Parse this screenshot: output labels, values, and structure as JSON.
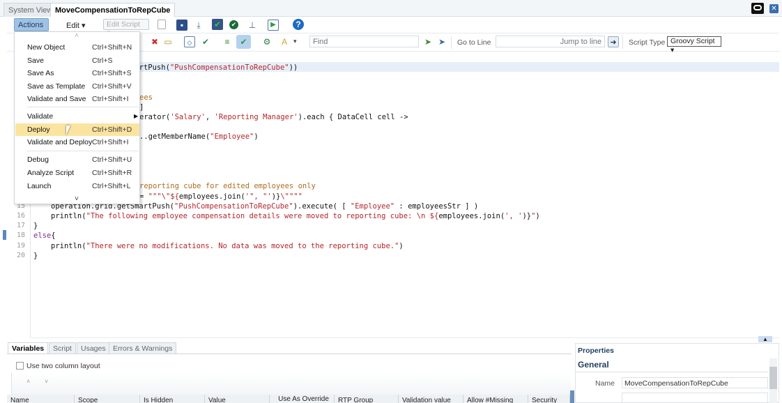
{
  "tabs": [
    {
      "label": "System View",
      "active": false
    },
    {
      "label": "MoveCompensationToRepCube",
      "active": true
    }
  ],
  "toolbar": {
    "actions_label": "Actions",
    "edit_label": "Edit",
    "edit_script_label": "Edit Script",
    "find_placeholder": "Find",
    "goto_label": "Go to Line",
    "jump_placeholder": "Jump to line",
    "script_type_label": "Script Type",
    "script_type_value": "Groovy Script"
  },
  "menu": {
    "items": [
      {
        "label": "New Object",
        "shortcut": "Ctrl+Shift+N"
      },
      {
        "label": "Save",
        "shortcut": "Ctrl+S"
      },
      {
        "label": "Save As",
        "shortcut": "Ctrl+Shift+S"
      },
      {
        "label": "Save as Template",
        "shortcut": "Ctrl+Shift+V"
      },
      {
        "label": "Validate and Save",
        "shortcut": "Ctrl+Shift+I",
        "sep_after": true
      },
      {
        "label": "Validate",
        "shortcut": "",
        "submenu": true
      },
      {
        "label": "Deploy",
        "shortcut": "Ctrl+Shift+D",
        "highlighted": true
      },
      {
        "label": "Validate and Deploy",
        "shortcut": "Ctrl+Shift+I",
        "sep_after": true
      },
      {
        "label": "Debug",
        "shortcut": "Ctrl+Shift+U"
      },
      {
        "label": "Analyze Script",
        "shortcut": "Ctrl+Shift+R"
      },
      {
        "label": "Launch",
        "shortcut": "Ctrl+Shift+L"
      }
    ]
  },
  "editor": {
    "lines": [
      {
        "n": 1,
        "indent": 187,
        "parts": [
          {
            "t": "martPush(",
            "c": "d"
          },
          {
            "t": "\"PushCompensationToRepCube\"",
            "c": "s"
          },
          {
            "t": "))",
            "c": "d"
          }
        ]
      },
      {
        "n": 4,
        "indent": 200,
        "parts": [
          {
            "t": "ees",
            "c": "c"
          }
        ]
      },
      {
        "n": 5,
        "indent": 200,
        "parts": [
          {
            "t": "]",
            "c": "d"
          }
        ]
      },
      {
        "n": 6,
        "indent": 200,
        "parts": [
          {
            "t": "erator(",
            "c": "d"
          },
          {
            "t": "'Salary'",
            "c": "s"
          },
          {
            "t": ", ",
            "c": "d"
          },
          {
            "t": "'Reporting Manager'",
            "c": "s"
          },
          {
            "t": ").each { DataCell cell ->",
            "c": "d"
          }
        ]
      },
      {
        "n": 8,
        "indent": 200,
        "parts": [
          {
            "t": "..getMemberName(",
            "c": "d"
          },
          {
            "t": "\"Employee\"",
            "c": "s"
          },
          {
            "t": ")",
            "c": "d"
          }
        ]
      },
      {
        "n": 13,
        "indent": 200,
        "parts": [
          {
            "t": "reporting cube for edited employees only",
            "c": "c"
          }
        ]
      },
      {
        "n": 14,
        "indent": 200,
        "parts": [
          {
            "t": "= ",
            "c": "d"
          },
          {
            "t": "\"\"\"\\\"${",
            "c": "s"
          },
          {
            "t": "employees.join(",
            "c": "d"
          },
          {
            "t": "'\", \"'",
            "c": "s"
          },
          {
            "t": ")}",
            "c": "d"
          },
          {
            "t": "\\\"\"\"\"",
            "c": "s"
          }
        ]
      },
      {
        "n": 15,
        "indent": 73,
        "parts": [
          {
            "t": "operation.grid.getSmartPush(",
            "c": "d"
          },
          {
            "t": "\"PushCompensationToRepCube\"",
            "c": "s"
          },
          {
            "t": ").execute( [ ",
            "c": "d"
          },
          {
            "t": "\"Employee\"",
            "c": "s"
          },
          {
            "t": " : employeesStr ] )",
            "c": "d"
          }
        ]
      },
      {
        "n": 16,
        "indent": 73,
        "parts": [
          {
            "t": "println(",
            "c": "d"
          },
          {
            "t": "\"The following employee compensation details were moved to reporting cube: \\n ${",
            "c": "s"
          },
          {
            "t": "employees.join(",
            "c": "d"
          },
          {
            "t": "', '",
            "c": "s"
          },
          {
            "t": ")}",
            "c": "d"
          },
          {
            "t": "\"",
            "c": "s"
          },
          {
            "t": ")",
            "c": "d"
          }
        ]
      },
      {
        "n": 17,
        "indent": 48,
        "parts": [
          {
            "t": "}",
            "c": "d"
          }
        ]
      },
      {
        "n": 18,
        "indent": 48,
        "parts": [
          {
            "t": "else",
            "c": "k"
          },
          {
            "t": "{",
            "c": "d"
          }
        ]
      },
      {
        "n": 19,
        "indent": 73,
        "parts": [
          {
            "t": "println(",
            "c": "d"
          },
          {
            "t": "\"There were no modifications. No data was moved to the reporting cube.\"",
            "c": "s"
          },
          {
            "t": ")",
            "c": "d"
          }
        ]
      },
      {
        "n": 20,
        "indent": 48,
        "parts": [
          {
            "t": "}",
            "c": "d"
          }
        ]
      }
    ]
  },
  "bottom": {
    "tabs": [
      {
        "label": "Variables",
        "active": true
      },
      {
        "label": "Script"
      },
      {
        "label": "Usages"
      },
      {
        "label": "Errors & Warnings"
      }
    ],
    "two_column_label": "Use two column layout",
    "two_column_checked": false,
    "columns": [
      "Name",
      "Scope",
      "Is Hidden",
      "Value",
      "Use As Override",
      "RTP Group",
      "Validation value",
      "Allow #Missing",
      "Security"
    ]
  },
  "properties": {
    "title": "Properties",
    "section": "General",
    "name_label": "Name",
    "name_value": "MoveCompensationToRepCube"
  }
}
